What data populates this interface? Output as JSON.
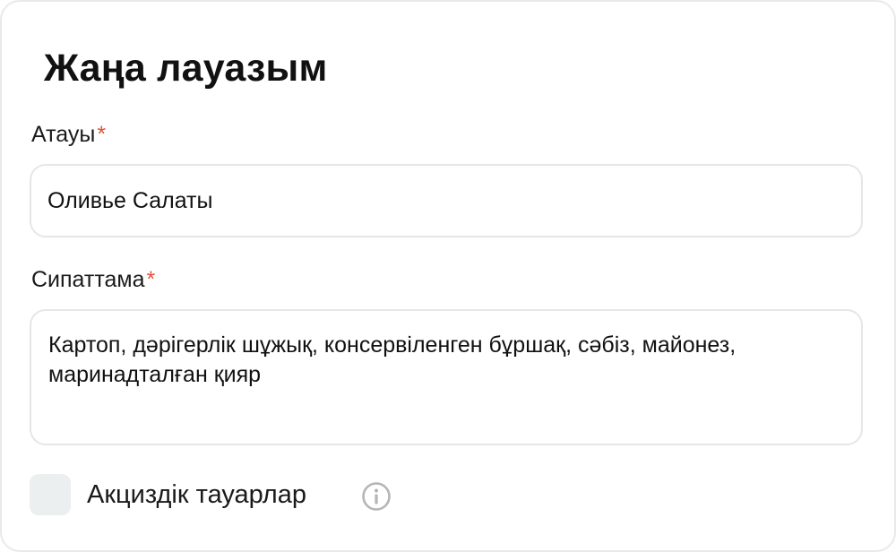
{
  "form": {
    "title": "Жаңа лауазым",
    "name_field": {
      "label": "Атауы",
      "required_mark": "*",
      "value": "Оливье Салаты"
    },
    "description_field": {
      "label": "Сипаттама",
      "required_mark": "*",
      "value": "Картоп, дәрігерлік шұжық, консервіленген бұршақ, сәбіз, майонез, маринадталған қияр"
    },
    "excise_checkbox": {
      "label": "Акциздік тауарлар",
      "checked": false,
      "info_icon": "info-icon"
    }
  },
  "colors": {
    "required": "#e0533d",
    "input_border": "#e6e6e6",
    "checkbox_fill": "#ecefef",
    "icon_gray": "#b5b5b5"
  }
}
